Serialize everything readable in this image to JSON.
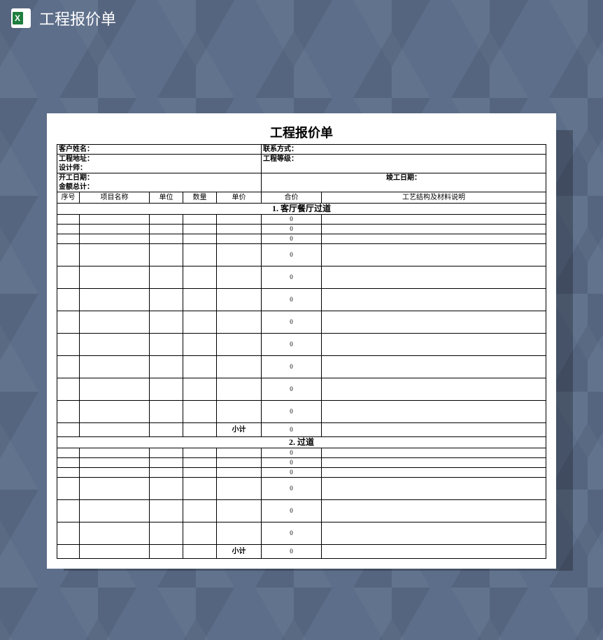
{
  "header": {
    "title": "工程报价单"
  },
  "doc": {
    "title": "工程报价单",
    "fields": {
      "customer_name": "客户姓名：",
      "contact": "联系方式：",
      "project_address": "工程地址：",
      "project_level": "工程等级：",
      "designer": "设计师：",
      "start_date": "开工日期：",
      "end_date": "竣工日期：",
      "total_amount": "金额总计："
    },
    "columns": {
      "seq": "序号",
      "item_name": "项目名称",
      "unit": "单位",
      "qty": "数量",
      "price": "单价",
      "total": "合价",
      "desc": "工艺结构及材料说明"
    },
    "sections": [
      {
        "title": "1. 客厅餐厅过道",
        "short_rows": [
          "0",
          "0",
          "0"
        ],
        "tall_rows": [
          "0",
          "0",
          "0",
          "0",
          "0",
          "0",
          "0",
          "0"
        ],
        "subtotal_label": "小计",
        "subtotal_value": "0"
      },
      {
        "title": "2. 过道",
        "short_rows": [
          "0",
          "0",
          "0"
        ],
        "tall_rows": [
          "0",
          "0",
          "0"
        ],
        "subtotal_label": "小计",
        "subtotal_value": "0"
      }
    ]
  }
}
